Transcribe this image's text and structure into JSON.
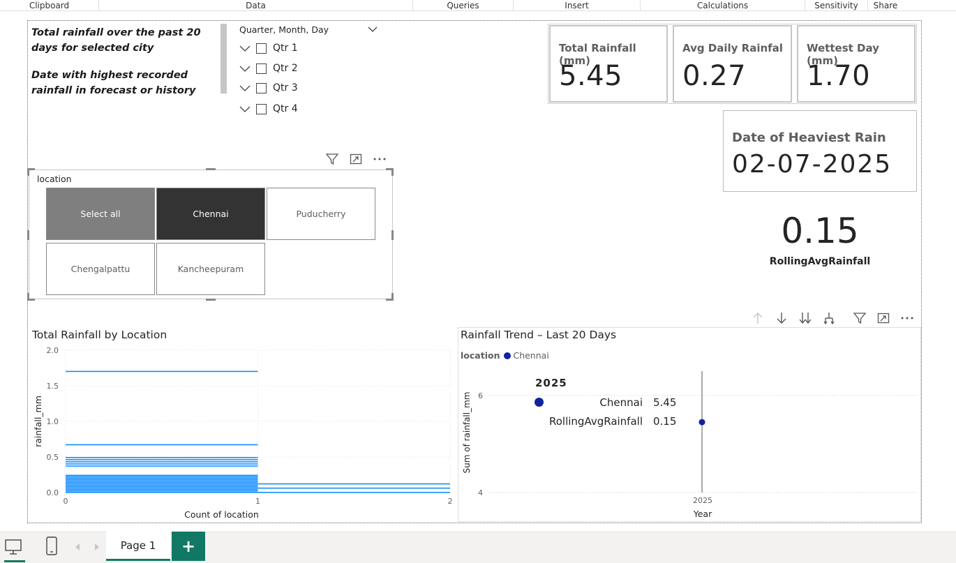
{
  "ribbon": {
    "groups": [
      "Clipboard",
      "Data",
      "Queries",
      "Insert",
      "Calculations",
      "Sensitivity",
      "Share"
    ]
  },
  "notes": {
    "line1": "Total rainfall over the past 20 days for selected city",
    "line2": "Date with highest recorded rainfall in forecast or history"
  },
  "hierarchy_slicer": {
    "title": "Quarter, Month, Day",
    "items": [
      "Qtr 1",
      "Qtr 2",
      "Qtr 3",
      "Qtr 4"
    ]
  },
  "cards": {
    "total": {
      "label": "Total Rainfall (mm)",
      "value": "5.45"
    },
    "avg": {
      "label": "Avg Daily Rainfal",
      "value": "0.27"
    },
    "wettest": {
      "label": "Wettest Day (mm)",
      "value": "1.70"
    },
    "heaviest": {
      "label": "Date of Heaviest Rain",
      "value": "02-07-2025"
    },
    "rolling": {
      "label": "RollingAvgRainfall",
      "value": "0.15"
    }
  },
  "location_slicer": {
    "title": "location",
    "tiles": [
      {
        "label": "Select all",
        "state": "partial"
      },
      {
        "label": "Chennai",
        "state": "selected"
      },
      {
        "label": "Puducherry",
        "state": "unselected"
      },
      {
        "label": "Chengalpattu",
        "state": "unselected"
      },
      {
        "label": "Kancheepuram",
        "state": "unselected"
      }
    ]
  },
  "chart_data": [
    {
      "type": "bar",
      "title": "Total Rainfall by Location",
      "xlabel": "Count of location",
      "ylabel": "rainfall_mm",
      "xlim": [
        0,
        2
      ],
      "ylim": [
        0,
        2
      ],
      "x_ticks": [
        "0",
        "1",
        "2"
      ],
      "y_ticks": [
        "0.0",
        "0.5",
        "1.0",
        "1.5",
        "2.0"
      ],
      "grid": true,
      "bars": [
        {
          "y": 1.7,
          "count": 1
        },
        {
          "y": 0.67,
          "count": 1
        },
        {
          "y": 0.49,
          "count": 1
        },
        {
          "y": 0.46,
          "count": 1
        },
        {
          "y": 0.43,
          "count": 1
        },
        {
          "y": 0.4,
          "count": 1
        },
        {
          "y": 0.37,
          "count": 1
        },
        {
          "y": 0.24,
          "count": 1
        },
        {
          "y": 0.22,
          "count": 1
        },
        {
          "y": 0.2,
          "count": 1
        },
        {
          "y": 0.18,
          "count": 1
        },
        {
          "y": 0.16,
          "count": 1
        },
        {
          "y": 0.14,
          "count": 1
        },
        {
          "y": 0.12,
          "count": 2
        },
        {
          "y": 0.1,
          "count": 1
        },
        {
          "y": 0.08,
          "count": 1
        },
        {
          "y": 0.06,
          "count": 2
        },
        {
          "y": 0.04,
          "count": 1
        },
        {
          "y": 0.02,
          "count": 1
        },
        {
          "y": 0.0,
          "count": 2
        }
      ],
      "bar_color": "#118dff"
    },
    {
      "type": "scatter",
      "title": "Rainfall Trend – Last 20 Days",
      "legend_title": "location",
      "series": [
        {
          "name": "Chennai",
          "color": "#12239e",
          "points": [
            {
              "x": 2025,
              "y": 5.45
            }
          ]
        }
      ],
      "xlabel": "Year",
      "ylabel": "Sum of rainfall_mm",
      "x_ticks": [
        "2025"
      ],
      "y_ticks": [
        "4",
        "6"
      ],
      "ylim": [
        4,
        6.5
      ],
      "tooltip": {
        "header": "2025",
        "rows": [
          {
            "label": "Chennai",
            "value": "5.45"
          },
          {
            "label": "RollingAvgRainfall",
            "value": "0.15"
          }
        ]
      }
    }
  ],
  "footer": {
    "page_tab": "Page 1",
    "add_label": "+"
  },
  "colors": {
    "accent": "#117865",
    "bar": "#118dff",
    "series": "#12239e"
  }
}
